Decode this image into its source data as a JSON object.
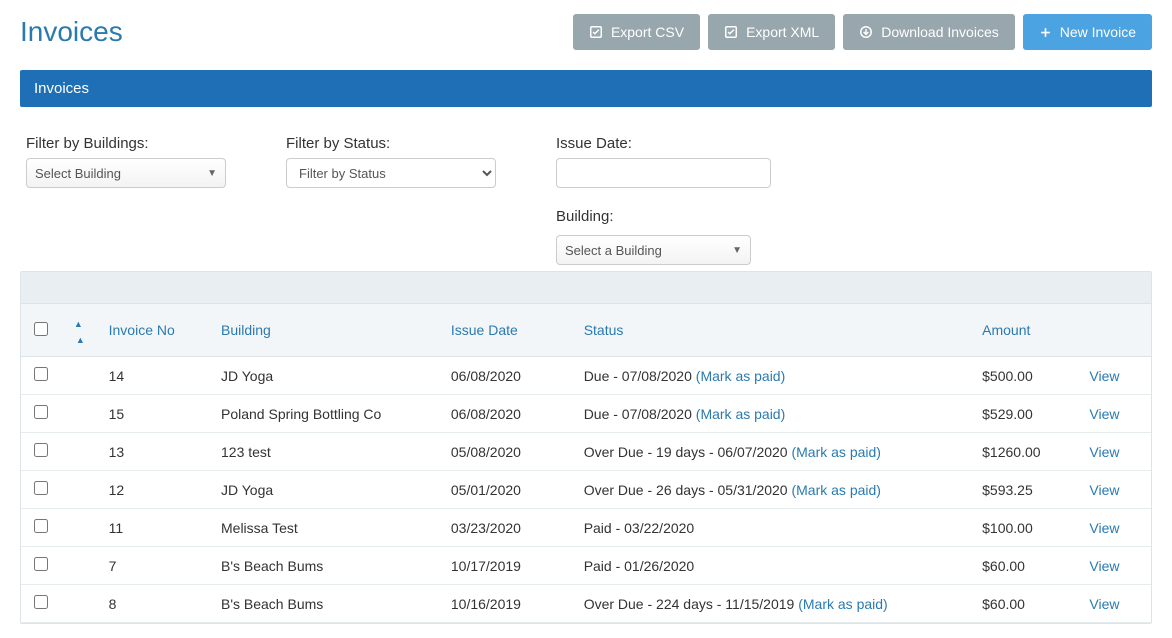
{
  "header": {
    "title": "Invoices",
    "buttons": {
      "export_csv": "Export CSV",
      "export_xml": "Export XML",
      "download": "Download Invoices",
      "new": "New Invoice"
    }
  },
  "panel": {
    "title": "Invoices"
  },
  "filters": {
    "buildings_label": "Filter by Buildings:",
    "buildings_select": "Select Building",
    "status_label": "Filter by Status:",
    "status_select": "Filter by Status",
    "issue_date_label": "Issue Date:",
    "issue_date_value": "",
    "building2_label": "Building:",
    "building2_select": "Select a Building"
  },
  "table": {
    "headers": {
      "invoice_no": "Invoice No",
      "building": "Building",
      "issue_date": "Issue Date",
      "status": "Status",
      "amount": "Amount"
    },
    "mark_as_paid": "(Mark as paid)",
    "view": "View",
    "rows": [
      {
        "invoice_no": "14",
        "building": "JD Yoga",
        "issue_date": "06/08/2020",
        "status_text": "Due - 07/08/2020 ",
        "mark": true,
        "amount": "$500.00"
      },
      {
        "invoice_no": "15",
        "building": "Poland Spring Bottling Co",
        "issue_date": "06/08/2020",
        "status_text": "Due - 07/08/2020 ",
        "mark": true,
        "amount": "$529.00"
      },
      {
        "invoice_no": "13",
        "building": "123 test",
        "issue_date": "05/08/2020",
        "status_text": "Over Due - 19 days - 06/07/2020 ",
        "mark": true,
        "amount": "$1260.00"
      },
      {
        "invoice_no": "12",
        "building": "JD Yoga",
        "issue_date": "05/01/2020",
        "status_text": "Over Due - 26 days - 05/31/2020 ",
        "mark": true,
        "amount": "$593.25"
      },
      {
        "invoice_no": "11",
        "building": "Melissa Test",
        "issue_date": "03/23/2020",
        "status_text": "Paid - 03/22/2020",
        "mark": false,
        "amount": "$100.00"
      },
      {
        "invoice_no": "7",
        "building": "B's Beach Bums",
        "issue_date": "10/17/2019",
        "status_text": "Paid - 01/26/2020",
        "mark": false,
        "amount": "$60.00"
      },
      {
        "invoice_no": "8",
        "building": "B's Beach Bums",
        "issue_date": "10/16/2019",
        "status_text": "Over Due - 224 days - 11/15/2019 ",
        "mark": true,
        "amount": "$60.00"
      }
    ]
  }
}
